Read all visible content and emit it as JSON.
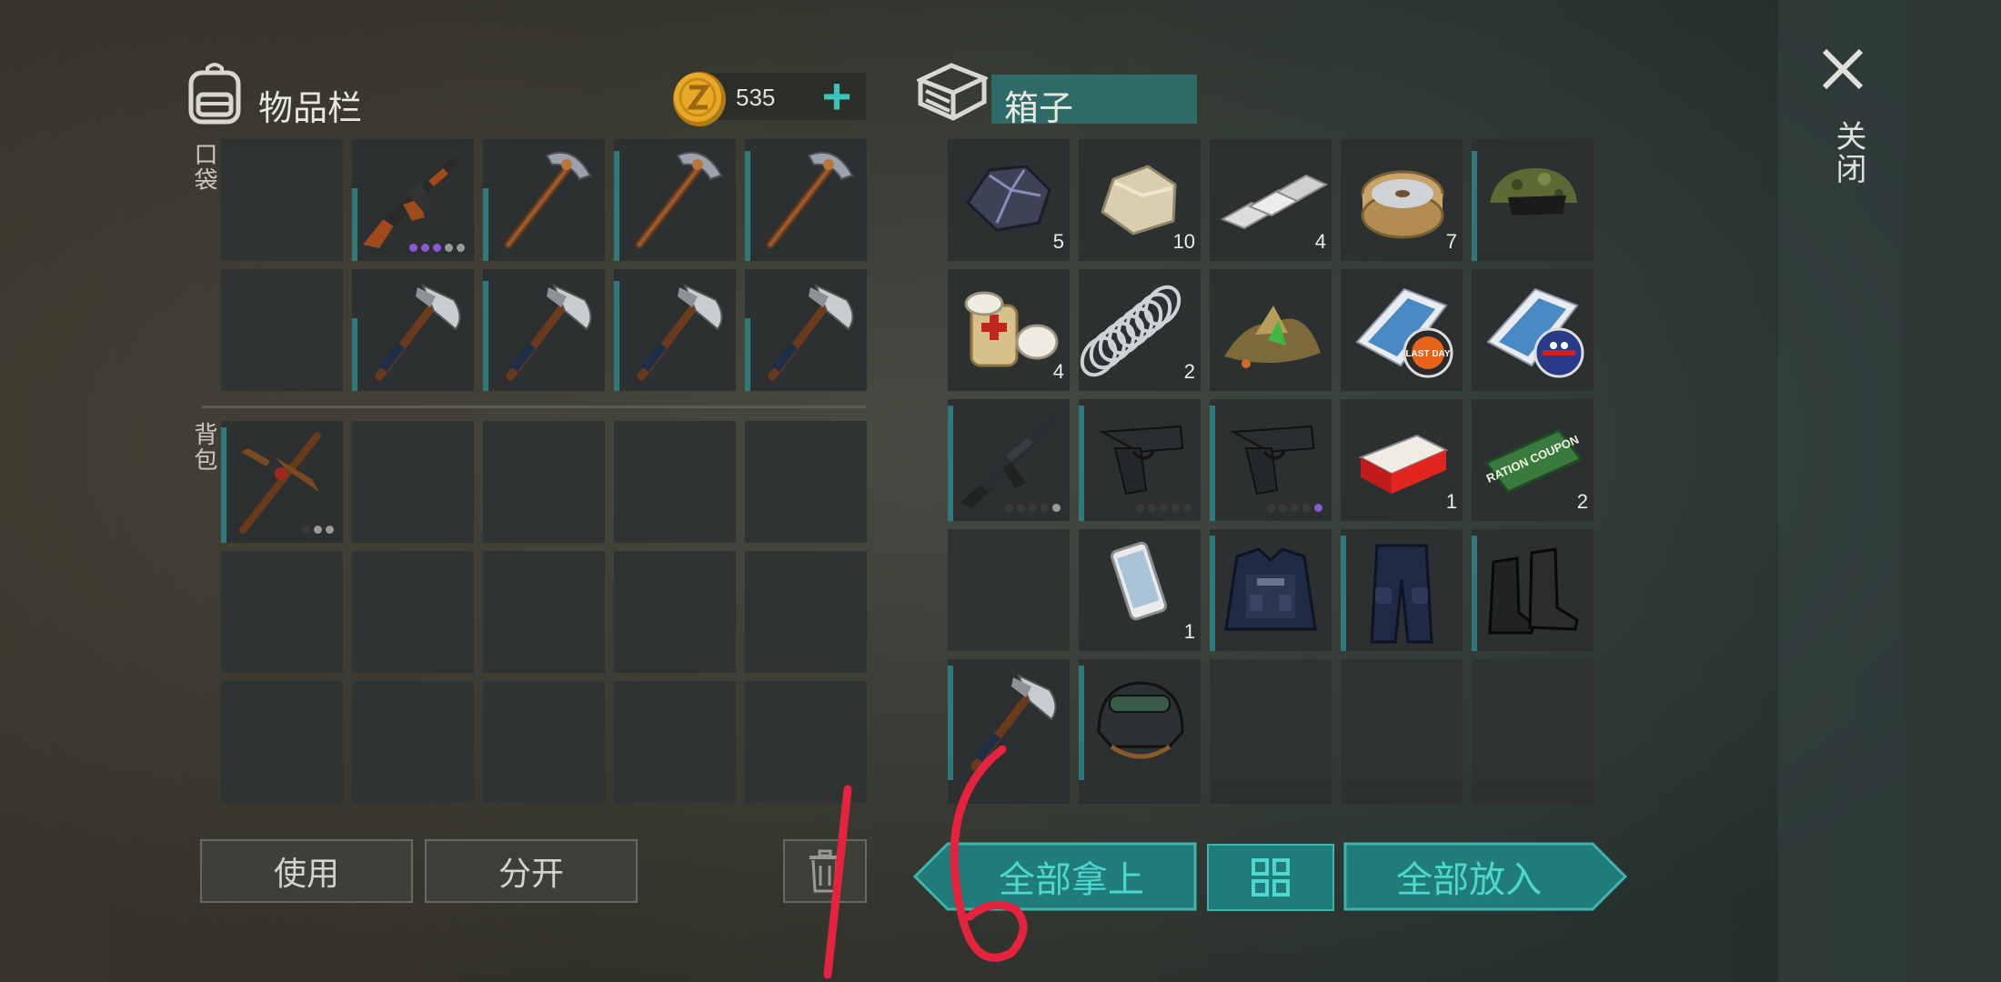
{
  "inventory": {
    "title": "物品栏",
    "pockets_label": "口袋",
    "backpack_label": "背包",
    "coins": "535",
    "add_label": "+",
    "pockets": [
      {
        "icon": "empty"
      },
      {
        "icon": "ak-rifle-icon",
        "bar": 0.6,
        "dots": [
          "p",
          "p",
          "p",
          "g",
          "g"
        ]
      },
      {
        "icon": "pickaxe-icon",
        "bar": 0.6
      },
      {
        "icon": "pickaxe-icon",
        "bar": 0.9
      },
      {
        "icon": "pickaxe-icon",
        "bar": 0.9
      },
      {
        "icon": "empty"
      },
      {
        "icon": "hatchet-icon",
        "bar": 0.6
      },
      {
        "icon": "hatchet-icon",
        "bar": 0.9
      },
      {
        "icon": "hatchet-icon",
        "bar": 0.9
      },
      {
        "icon": "hatchet-icon",
        "bar": 0.6
      }
    ],
    "backpack": [
      {
        "icon": "crafted-pickaxe-icon",
        "bar": 0.95,
        "dots": [
          "d",
          "g",
          "g"
        ]
      },
      {
        "icon": "empty"
      },
      {
        "icon": "empty"
      },
      {
        "icon": "empty"
      },
      {
        "icon": "empty"
      },
      {
        "icon": "empty"
      },
      {
        "icon": "empty"
      },
      {
        "icon": "empty"
      },
      {
        "icon": "empty"
      },
      {
        "icon": "empty"
      },
      {
        "icon": "empty"
      },
      {
        "icon": "empty"
      },
      {
        "icon": "empty"
      },
      {
        "icon": "empty"
      },
      {
        "icon": "empty"
      }
    ],
    "use_label": "使用",
    "split_label": "分开"
  },
  "box": {
    "title": "箱子",
    "items": [
      {
        "icon": "iron-ore-icon",
        "qty": "5"
      },
      {
        "icon": "stone-icon",
        "qty": "10"
      },
      {
        "icon": "metal-bar-icon",
        "qty": "4"
      },
      {
        "icon": "wire-spool-icon",
        "qty": "7"
      },
      {
        "icon": "camo-cap-icon",
        "bar": 0.9
      },
      {
        "icon": "bandage-icon",
        "qty": "4"
      },
      {
        "icon": "spring-icon",
        "qty": "2"
      },
      {
        "icon": "herbs-pile-icon"
      },
      {
        "icon": "last-day-magazine-icon"
      },
      {
        "icon": "flag-magazine-icon"
      },
      {
        "icon": "m16-rifle-icon",
        "bar": 0.95,
        "dots": [
          "d",
          "d",
          "d",
          "d",
          "g"
        ]
      },
      {
        "icon": "pistol-icon",
        "bar": 0.95,
        "dots": [
          "d",
          "d",
          "d",
          "d",
          "d"
        ]
      },
      {
        "icon": "pistol-icon",
        "bar": 0.95,
        "dots": [
          "d",
          "d",
          "d",
          "d",
          "p"
        ]
      },
      {
        "icon": "cigarettes-icon",
        "qty": "1"
      },
      {
        "icon": "ration-coupon-icon",
        "qty": "2"
      },
      {
        "icon": "empty"
      },
      {
        "icon": "smartphone-icon",
        "qty": "1"
      },
      {
        "icon": "police-vest-icon",
        "bar": 0.95
      },
      {
        "icon": "police-pants-icon",
        "bar": 0.95
      },
      {
        "icon": "police-boots-icon",
        "bar": 0.95
      },
      {
        "icon": "hatchet-icon",
        "bar": 0.95
      },
      {
        "icon": "riot-helmet-icon",
        "bar": 0.95
      },
      {
        "icon": "empty"
      },
      {
        "icon": "empty"
      },
      {
        "icon": "empty"
      }
    ],
    "take_all_label": "全部拿上",
    "put_all_label": "全部放入",
    "close_label": "关闭",
    "ration_text": "RATION COUPON",
    "magazine_text": "LAST DAY"
  },
  "colors": {
    "teal": "#1f7c78",
    "teal_text": "#4fd6cf",
    "slot": "#2c3030",
    "bar": "#2f7a78"
  },
  "handwriting": "16"
}
